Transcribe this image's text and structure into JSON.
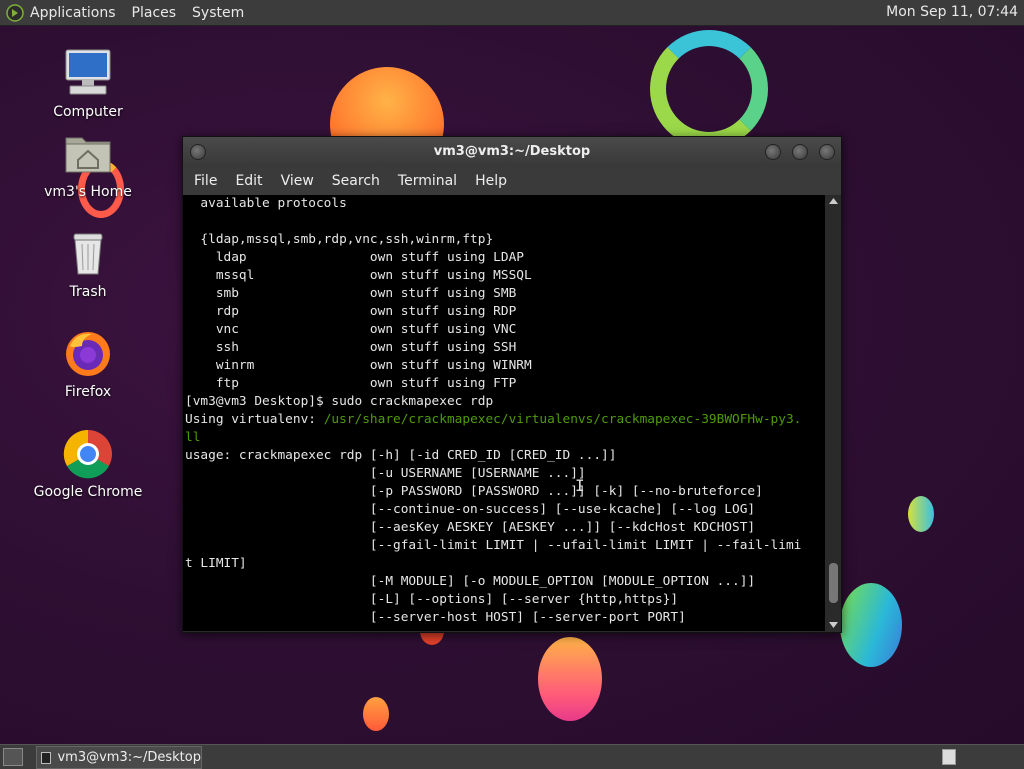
{
  "top_panel": {
    "menus": [
      "Applications",
      "Places",
      "System"
    ],
    "clock": "Mon Sep 11, 07:44"
  },
  "desktop_icons": [
    {
      "label": "Computer",
      "icon": "computer-icon"
    },
    {
      "label": "vm3's Home",
      "icon": "home-folder-icon"
    },
    {
      "label": "Trash",
      "icon": "trash-icon"
    },
    {
      "label": "Firefox",
      "icon": "firefox-icon"
    },
    {
      "label": "Google Chrome",
      "icon": "chrome-icon"
    }
  ],
  "terminal": {
    "title": "vm3@vm3:~/Desktop",
    "menu": [
      "File",
      "Edit",
      "View",
      "Search",
      "Terminal",
      "Help"
    ],
    "lines": [
      "  available protocols",
      "",
      "  {ldap,mssql,smb,rdp,vnc,ssh,winrm,ftp}",
      "    ldap                own stuff using LDAP",
      "    mssql               own stuff using MSSQL",
      "    smb                 own stuff using SMB",
      "    rdp                 own stuff using RDP",
      "    vnc                 own stuff using VNC",
      "    ssh                 own stuff using SSH",
      "    winrm               own stuff using WINRM",
      "    ftp                 own stuff using FTP",
      "[vm3@vm3 Desktop]$ sudo crackmapexec rdp",
      "Using virtualenv: ",
      "ll",
      "usage: crackmapexec rdp [-h] [-id CRED_ID [CRED_ID ...]]",
      "                        [-u USERNAME [USERNAME ...]]",
      "                        [-p PASSWORD [PASSWORD ...]] [-k] [--no-bruteforce]",
      "                        [--continue-on-success] [--use-kcache] [--log LOG]",
      "                        [--aesKey AESKEY [AESKEY ...]] [--kdcHost KDCHOST]",
      "                        [--gfail-limit LIMIT | --ufail-limit LIMIT | --fail-limi",
      "t LIMIT]",
      "                        [-M MODULE] [-o MODULE_OPTION [MODULE_OPTION ...]]",
      "                        [-L] [--options] [--server {http,https}]",
      "                        [--server-host HOST] [--server-port PORT]"
    ],
    "virtualenv_path": "/usr/share/crackmapexec/virtualenvs/crackmapexec-39BWOFHw-py3."
  },
  "taskbar": {
    "task_label": "vm3@vm3:~/Desktop"
  },
  "colors": {
    "panel": "#3c3c3c",
    "terminal_bg": "#000000",
    "terminal_fg": "#e6e6e6",
    "path_green": "#4e9a06"
  }
}
